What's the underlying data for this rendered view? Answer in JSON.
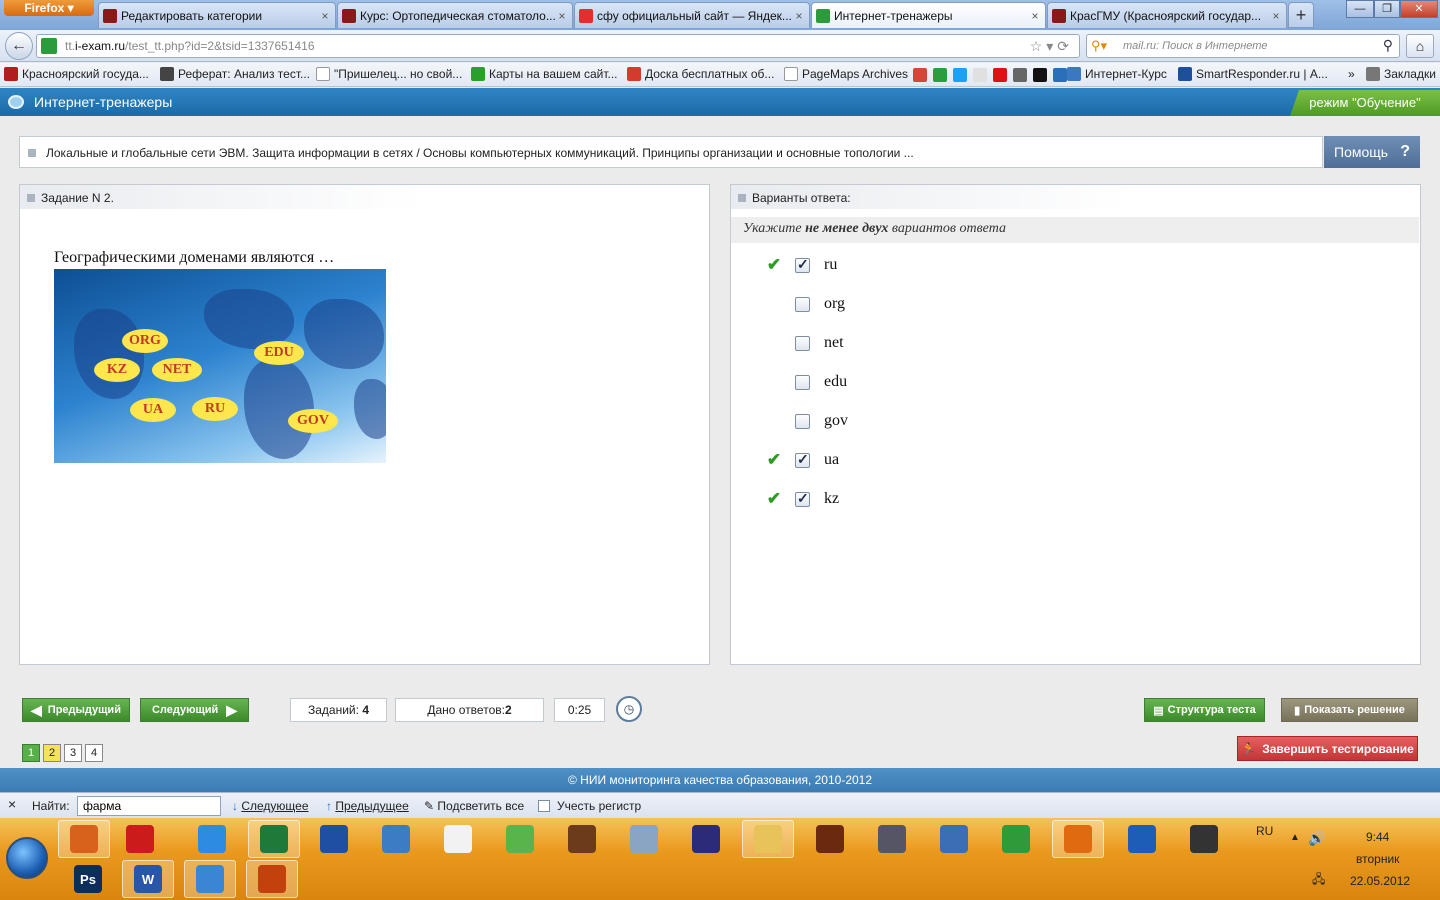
{
  "browser": {
    "menu_label": "Firefox",
    "tabs": [
      {
        "title": "Редактировать категории",
        "color": "#8a1a1a"
      },
      {
        "title": "Курс: Ортопедическая стоматоло...",
        "color": "#8a1a1a"
      },
      {
        "title": "сфу официальный сайт — Яндек...",
        "color": "#e52e2e"
      },
      {
        "title": "Интернет-тренажеры",
        "color": "#2d9a3c"
      },
      {
        "title": "КрасГМУ (Красноярский государ...",
        "color": "#8a1a1a"
      }
    ],
    "new_tab_label": "+",
    "window_buttons": [
      "—",
      "❐",
      "✕"
    ],
    "url": {
      "host_prefix": "tt.",
      "host": "i-exam.ru",
      "path": "/test_tt.php?id=2&tsid=1337651416"
    },
    "search_placeholder": "mail.ru: Поиск в Интернете",
    "bookmarks": [
      {
        "label": "Красноярский госуда...",
        "color": "#b01e1e"
      },
      {
        "label": "Реферат: Анализ тест...",
        "color": "#444444"
      },
      {
        "label": "\"Пришелец... но свой...",
        "color": "#cccccc"
      },
      {
        "label": "Карты на вашем сайт...",
        "color": "#2aa02a"
      },
      {
        "label": "Доска бесплатных об...",
        "color": "#d33b2c"
      },
      {
        "label": "PageMaps Archives",
        "color": "#cccccc"
      },
      {
        "label": "Интернет-Курс",
        "color": "#3a78c2"
      },
      {
        "label": "SmartResponder.ru | А...",
        "color": "#1c4f9c"
      }
    ],
    "bookmark_icon_colors": [
      "#d44638",
      "#2a9d3c",
      "#1da1f2",
      "#e0e0e0",
      "#d11",
      "#666",
      "#111",
      "#2a6fb8"
    ],
    "bookmarks_overflow": "»",
    "bookmarks_menu": "Закладки"
  },
  "site": {
    "title": "Интернет-тренажеры",
    "mode": "режим \"Обучение\"",
    "topic": "Локальные и глобальные сети ЭВМ. Защита информации в сетях / Основы компьютерных коммуникаций. Принципы организации и основные топологии ...",
    "help_label": "Помощь",
    "help_icon": "?",
    "task_header": "Задание N 2.",
    "question": "Географическими доменами являются …",
    "image_labels": [
      "ORG",
      "KZ",
      "NET",
      "EDU",
      "UA",
      "RU",
      "GOV"
    ],
    "answers_header": "Варианты ответа:",
    "instruction_pre": "Укажите ",
    "instruction_bold": "не менее двух",
    "instruction_post": " вариантов ответа",
    "options": [
      {
        "label": "ru",
        "checked": true,
        "correct": true
      },
      {
        "label": "org",
        "checked": false,
        "correct": false
      },
      {
        "label": "net",
        "checked": false,
        "correct": false
      },
      {
        "label": "edu",
        "checked": false,
        "correct": false
      },
      {
        "label": "gov",
        "checked": false,
        "correct": false
      },
      {
        "label": "ua",
        "checked": true,
        "correct": true
      },
      {
        "label": "kz",
        "checked": true,
        "correct": true
      }
    ],
    "prev_label": "Предыдущий",
    "next_label": "Следующий",
    "tasks_label": "Заданий:",
    "tasks_value": "4",
    "answered_label": "Дано ответов:",
    "answered_value": "2",
    "timer": "0:25",
    "structure_label": "Структура теста",
    "show_solution_label": "Показать решение",
    "finish_label": "Завершить тестирование",
    "pages": [
      "1",
      "2",
      "3",
      "4"
    ],
    "current_page": "2",
    "footer": "© НИИ мониторинга качества образования, 2010-2012"
  },
  "findbar": {
    "close": "×",
    "label": "Найти:",
    "value": "фарма",
    "next": "Следующее",
    "prev": "Предыдущее",
    "highlight": "Подсветить все",
    "match_case": "Учесть регистр"
  },
  "taskbar": {
    "apps_row1": [
      {
        "name": "firefox-icon",
        "color": "#d8611c",
        "active": true
      },
      {
        "name": "opera-icon",
        "color": "#cc1b1b",
        "active": false
      },
      {
        "name": "ie-icon",
        "color": "#2d8be0",
        "active": false
      },
      {
        "name": "excel-icon",
        "color": "#1f7a3a",
        "active": true
      },
      {
        "name": "db-icon",
        "color": "#1e4fa0",
        "active": false
      },
      {
        "name": "media-icon",
        "color": "#3c7cc4",
        "active": false
      },
      {
        "name": "file-icon",
        "color": "#f2f2f2",
        "active": false
      },
      {
        "name": "flask-icon",
        "color": "#5ab44c",
        "active": false
      },
      {
        "name": "paint-icon",
        "color": "#6b3b1c",
        "active": false
      },
      {
        "name": "calculator-icon",
        "color": "#8aa4c4",
        "active": false
      },
      {
        "name": "floppy-icon",
        "color": "#2b2b7a",
        "active": false
      },
      {
        "name": "explorer-icon",
        "color": "#e8c35a",
        "active": true
      },
      {
        "name": "bridge-icon",
        "color": "#6b2a10",
        "active": false
      },
      {
        "name": "tools-icon",
        "color": "#556",
        "active": false
      },
      {
        "name": "shield-icon",
        "color": "#3b6fb5",
        "active": false
      },
      {
        "name": "network-icon",
        "color": "#2e9a3a",
        "active": false
      },
      {
        "name": "chrome-warning-icon",
        "color": "#e06a10",
        "active": true
      },
      {
        "name": "grid-icon",
        "color": "#1d5db8",
        "active": false
      },
      {
        "name": "graduation-icon",
        "color": "#333333",
        "active": false
      }
    ],
    "apps_row2": [
      {
        "name": "photoshop-icon",
        "color": "#0d2e5a",
        "text": "Ps",
        "active": false
      },
      {
        "name": "word-icon",
        "color": "#2a56a8",
        "text": "W",
        "active": true
      },
      {
        "name": "windows-icon",
        "color": "#3a86d4",
        "text": "",
        "active": true
      },
      {
        "name": "powerpoint-icon",
        "color": "#c2410c",
        "text": "",
        "active": true
      }
    ],
    "lang": "RU",
    "time": "9:44",
    "weekday": "вторник",
    "date": "22.05.2012"
  }
}
